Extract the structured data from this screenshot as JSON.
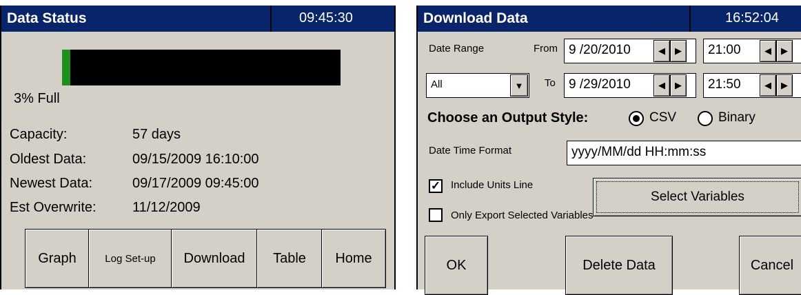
{
  "data_status": {
    "title": "Data Status",
    "time": "09:45:30",
    "fill_percent": 3,
    "fill_label": "3% Full",
    "rows": [
      {
        "label": "Capacity:",
        "value": "57 days"
      },
      {
        "label": "Oldest Data:",
        "value": "09/15/2009 16:10:00"
      },
      {
        "label": "Newest Data:",
        "value": "09/17/2009 09:45:00"
      },
      {
        "label": "Est Overwrite:",
        "value": "11/12/2009"
      }
    ],
    "buttons": [
      "Graph",
      "Log Set-up",
      "Download",
      "Table",
      "Home"
    ],
    "accent_color": "#08246b",
    "fill_color": "#1e8f1e"
  },
  "download_data": {
    "title": "Download Data",
    "time": "16:52:04",
    "date_range_label": "Date Range",
    "from_label": "From",
    "to_label": "To",
    "from_date": "9 /20/2010",
    "from_time": "21:00",
    "to_date": "9 /29/2010",
    "to_time": "21:50",
    "range_select": "All",
    "output_style_label": "Choose an Output Style:",
    "output_options": [
      "CSV",
      "Binary"
    ],
    "output_selected": "CSV",
    "datetime_format_label": "Date Time Format",
    "datetime_format_value": "yyyy/MM/dd HH:mm:ss",
    "include_units_label": "Include Units Line",
    "include_units_checked": true,
    "only_export_label": "Only Export Selected Variables",
    "only_export_checked": false,
    "select_variables_label": "Select Variables",
    "ok_label": "OK",
    "delete_label": "Delete Data",
    "cancel_label": "Cancel",
    "arrow_left": "◀",
    "arrow_right": "▶",
    "dropdown_arrow": "▼",
    "check_mark": "✓"
  }
}
